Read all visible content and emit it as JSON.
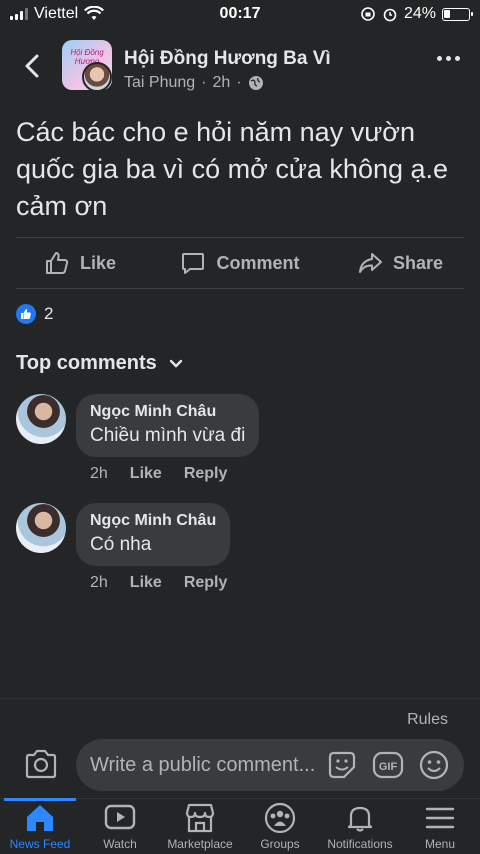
{
  "status_bar": {
    "carrier": "Viettel",
    "time": "00:17",
    "battery": "24%"
  },
  "header": {
    "group_name": "Hội Đồng Hương Ba Vì",
    "author": "Tai Phung",
    "time_ago": "2h",
    "avatar_text": "Hội Đồng Hương"
  },
  "post": {
    "text": "Các bác cho e hỏi năm nay vườn quốc gia ba vì có mở cửa không ạ.e cảm ơn",
    "reaction_count": "2"
  },
  "actions": {
    "like": "Like",
    "comment": "Comment",
    "share": "Share"
  },
  "comments_section": {
    "title": "Top comments"
  },
  "comments": [
    {
      "name": "Ngọc Minh Châu",
      "text": "Chiều mình vừa đi",
      "time": "2h",
      "like": "Like",
      "reply": "Reply"
    },
    {
      "name": "Ngọc Minh Châu",
      "text": "Có nha",
      "time": "2h",
      "like": "Like",
      "reply": "Reply"
    }
  ],
  "composer": {
    "rules": "Rules",
    "placeholder": "Write a public comment..."
  },
  "tabs": [
    {
      "label": "News Feed",
      "icon": "home-icon",
      "active": true
    },
    {
      "label": "Watch",
      "icon": "watch-icon"
    },
    {
      "label": "Marketplace",
      "icon": "marketplace-icon"
    },
    {
      "label": "Groups",
      "icon": "groups-icon"
    },
    {
      "label": "Notifications",
      "icon": "bell-icon"
    },
    {
      "label": "Menu",
      "icon": "menu-icon"
    }
  ],
  "colors": {
    "background": "#242526",
    "accent": "#2d88ff",
    "bubble": "#3a3b3c"
  }
}
